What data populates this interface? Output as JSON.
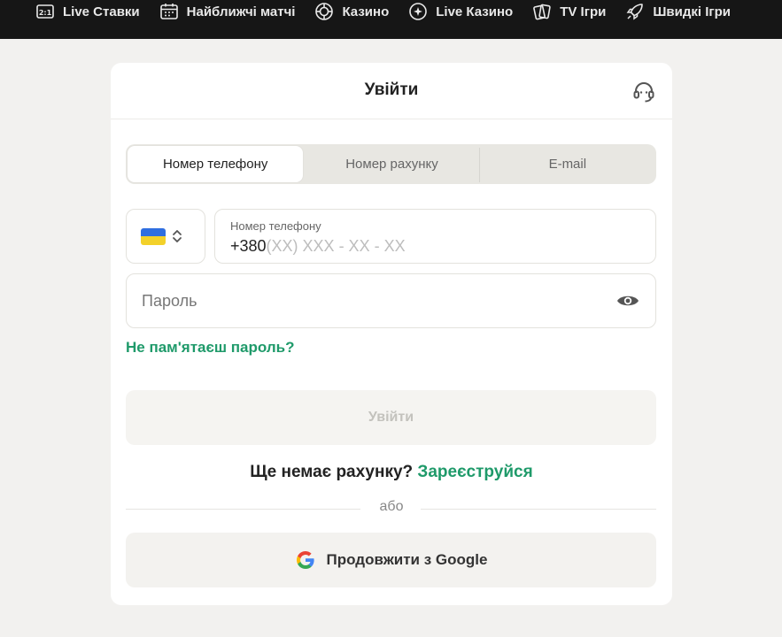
{
  "nav": {
    "items": [
      {
        "label": "Live Ставки",
        "icon": "live-bets-icon"
      },
      {
        "label": "Найближчі матчі",
        "icon": "calendar-icon"
      },
      {
        "label": "Казино",
        "icon": "casino-chip-icon"
      },
      {
        "label": "Live Казино",
        "icon": "live-casino-icon"
      },
      {
        "label": "TV Ігри",
        "icon": "cards-icon"
      },
      {
        "label": "Швидкі Ігри",
        "icon": "rocket-icon"
      }
    ]
  },
  "login": {
    "title": "Увійти",
    "tabs": [
      {
        "label": "Номер телефону",
        "active": true
      },
      {
        "label": "Номер рахунку",
        "active": false
      },
      {
        "label": "E-mail",
        "active": false
      }
    ],
    "phone": {
      "label": "Номер телефону",
      "prefix": "+380",
      "mask": "(XX) XXX - XX - XX"
    },
    "password": {
      "placeholder": "Пароль"
    },
    "forgot_link": "Не пам'ятаєш пароль?",
    "submit_label": "Увійти",
    "register_prompt": "Ще немає рахунку?",
    "register_link": "Зареєструйся",
    "divider_text": "або",
    "google_label": "Продовжити з Google"
  },
  "colors": {
    "accent": "#1f9a6a",
    "nav_bg": "#161616",
    "page_bg": "#f2f1ef"
  }
}
